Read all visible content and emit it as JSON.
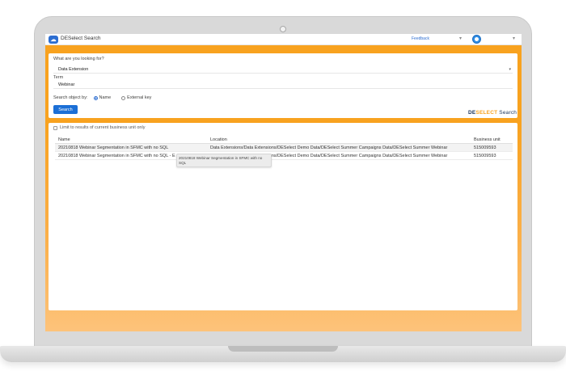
{
  "app": {
    "title": "DESelect Search",
    "feedback_label": "Feedback",
    "logo_glyph": "☁"
  },
  "search": {
    "question_label": "What are you looking for?",
    "type_value": "Data Extension",
    "term_label": "Term",
    "term_value": "Webinar",
    "search_by_label": "Search object by:",
    "options": [
      "Name",
      "External key"
    ],
    "selected_option": "Name",
    "button_label": "Search"
  },
  "brand": {
    "part1": "DE",
    "part2": "SELECT",
    "part3": " Search"
  },
  "results": {
    "limit_label": "Limit to results of current business unit only",
    "columns": [
      "Name",
      "Location",
      "Business unit"
    ],
    "rows": [
      {
        "name": "20210818 Webinar Segmentation in SFMC with no SQL",
        "location": "Data Extensions/Data Extensions/DESelect Demo Data/DESelect Summer Campaigns Data/DESelect Summer Webinar",
        "business_unit": "515009593"
      },
      {
        "name": "20210818 Webinar Segmentation in SFMC with no SQL - E",
        "location": "Data Extensions/Data Extensions/DESelect Demo Data/DESelect Summer Campaigns Data/DESelect Summer Webinar",
        "business_unit": "515009593"
      }
    ],
    "tooltip": "20210818 Webinar Segmentation in SFMC with no SQL"
  },
  "colors": {
    "accent_orange": "#f8a21f",
    "primary_blue": "#1b6fd6",
    "brand_navy": "#16325c"
  }
}
